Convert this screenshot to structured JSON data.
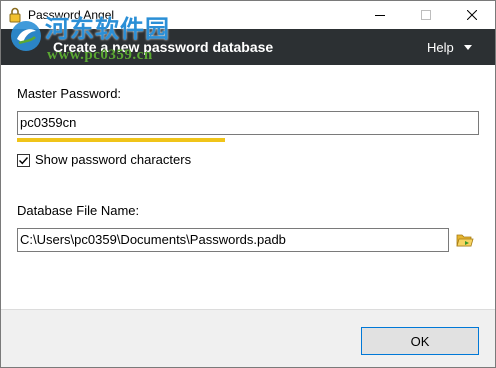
{
  "window": {
    "title": "Password Angel"
  },
  "watermark": {
    "title": "河东软件园",
    "url": "www.pc0359.cn"
  },
  "header": {
    "title": "Create a new password database",
    "help_label": "Help"
  },
  "form": {
    "master_password_label": "Master Password:",
    "master_password_value": "pc0359cn",
    "password_strength": 0.45,
    "show_password_checked": true,
    "show_password_label": "Show password characters",
    "database_file_label": "Database File Name:",
    "database_file_value": "C:\\Users\\pc0359\\Documents\\Passwords.padb"
  },
  "footer": {
    "ok_label": "OK"
  },
  "colors": {
    "header_bg": "#2c3033",
    "strength_bar": "#f0c419",
    "footer_bg": "#f0f0f0",
    "ok_border": "#0078d7"
  }
}
